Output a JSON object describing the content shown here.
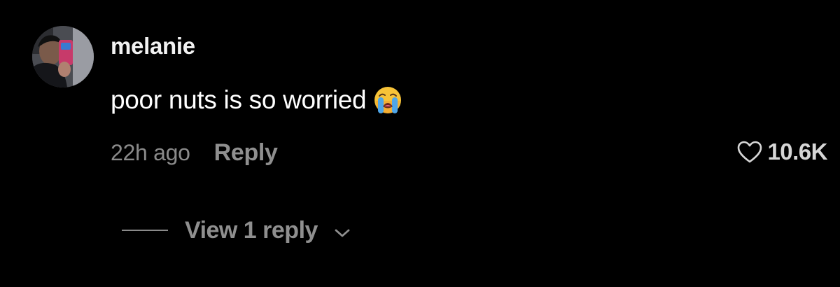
{
  "comment": {
    "username": "melanie",
    "text": "poor nuts is so worried",
    "emoji": "loudly-crying-face",
    "timestamp": "22h ago",
    "reply_label": "Reply",
    "likes": "10.6K",
    "like_icon": "heart-outline-icon",
    "view_replies_label": "View 1 reply",
    "view_replies_icon": "chevron-down-icon"
  },
  "colors": {
    "background": "#000000",
    "primary_text": "#ffffff",
    "secondary_text": "#8a8a8a"
  }
}
